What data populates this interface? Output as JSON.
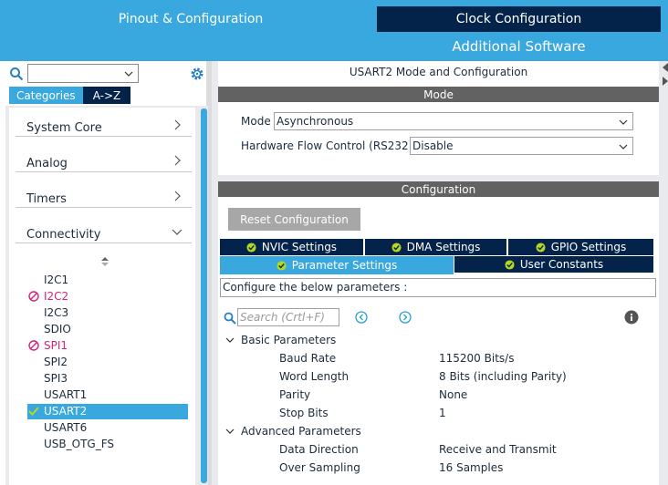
{
  "top_tabs": {
    "pinout": "Pinout & Configuration",
    "clock": "Clock Configuration",
    "additional": "Additional Software"
  },
  "left": {
    "search_value": "",
    "category_tabs": [
      "Categories",
      "A->Z"
    ],
    "categories": [
      {
        "label": "System Core",
        "state": "collapsed"
      },
      {
        "label": "Analog",
        "state": "collapsed"
      },
      {
        "label": "Timers",
        "state": "collapsed"
      },
      {
        "label": "Connectivity",
        "state": "expanded"
      }
    ],
    "peripherals": [
      {
        "label": "I2C1",
        "status": "none"
      },
      {
        "label": "I2C2",
        "status": "disabled"
      },
      {
        "label": "I2C3",
        "status": "none"
      },
      {
        "label": "SDIO",
        "status": "none"
      },
      {
        "label": "SPI1",
        "status": "disabled"
      },
      {
        "label": "SPI2",
        "status": "none"
      },
      {
        "label": "SPI3",
        "status": "none"
      },
      {
        "label": "USART1",
        "status": "none"
      },
      {
        "label": "USART2",
        "status": "enabled",
        "selected": true
      },
      {
        "label": "USART6",
        "status": "none"
      },
      {
        "label": "USB_OTG_FS",
        "status": "none"
      }
    ]
  },
  "right": {
    "title": "USART2 Mode and Configuration",
    "mode_section": "Mode",
    "mode_label": "Mode",
    "mode_value": "Asynchronous",
    "flow_label": "Hardware Flow Control (RS232)",
    "flow_value": "Disable",
    "config_section": "Configuration",
    "reset_button": "Reset Configuration",
    "tabs_row1": [
      "NVIC Settings",
      "DMA Settings",
      "GPIO Settings"
    ],
    "tabs_row2": [
      "Parameter Settings",
      "User Constants"
    ],
    "active_tab": "Parameter Settings",
    "hint": "Configure the below parameters :",
    "filter_placeholder": "Search (Crtl+F)",
    "groups": [
      {
        "title": "Basic Parameters",
        "params": [
          {
            "name": "Baud Rate",
            "value": "115200 Bits/s"
          },
          {
            "name": "Word Length",
            "value": "8 Bits (including Parity)"
          },
          {
            "name": "Parity",
            "value": "None"
          },
          {
            "name": "Stop Bits",
            "value": "1"
          }
        ]
      },
      {
        "title": "Advanced Parameters",
        "params": [
          {
            "name": "Data Direction",
            "value": "Receive and Transmit"
          },
          {
            "name": "Over Sampling",
            "value": "16 Samples"
          }
        ]
      }
    ]
  },
  "colors": {
    "accent_blue": "#39a8df",
    "dark_navy": "#03234b",
    "section_gray": "#626262",
    "disabled_pink": "#d6237a",
    "enabled_green": "#b6d620"
  }
}
